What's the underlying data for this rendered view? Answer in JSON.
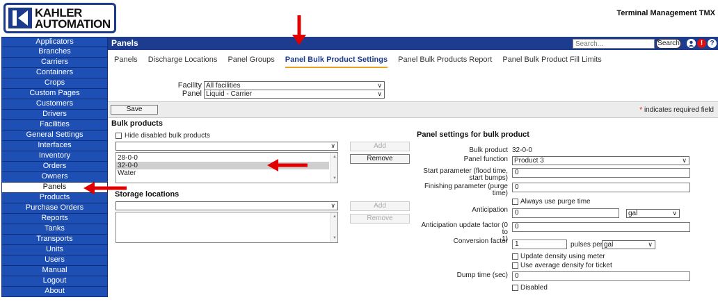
{
  "brand": {
    "logo_line1": "KAHLER",
    "logo_line2": "AUTOMATION",
    "app_title": "Terminal Management TMX"
  },
  "sidebar": {
    "items": [
      {
        "label": "Applicators"
      },
      {
        "label": "Branches"
      },
      {
        "label": "Carriers"
      },
      {
        "label": "Containers"
      },
      {
        "label": "Crops"
      },
      {
        "label": "Custom Pages"
      },
      {
        "label": "Customers"
      },
      {
        "label": "Drivers"
      },
      {
        "label": "Facilities"
      },
      {
        "label": "General Settings"
      },
      {
        "label": "Interfaces"
      },
      {
        "label": "Inventory"
      },
      {
        "label": "Orders"
      },
      {
        "label": "Owners"
      },
      {
        "label": "Panels"
      },
      {
        "label": "Products"
      },
      {
        "label": "Purchase Orders"
      },
      {
        "label": "Reports"
      },
      {
        "label": "Tanks"
      },
      {
        "label": "Transports"
      },
      {
        "label": "Units"
      },
      {
        "label": "Users"
      },
      {
        "label": "Manual"
      },
      {
        "label": "Logout"
      },
      {
        "label": "About"
      }
    ],
    "active_label": "Panels"
  },
  "header": {
    "title": "Panels",
    "search_placeholder": "Search...",
    "search_button": "Search",
    "icons": [
      "user-icon",
      "alert-icon",
      "help-icon"
    ],
    "alert_glyph": "!",
    "help_glyph": "?"
  },
  "tabs": [
    {
      "label": "Panels"
    },
    {
      "label": "Discharge Locations"
    },
    {
      "label": "Panel Groups"
    },
    {
      "label": "Panel Bulk Product Settings"
    },
    {
      "label": "Panel Bulk Products Report"
    },
    {
      "label": "Panel Bulk Product Fill Limits"
    }
  ],
  "active_tab": "Panel Bulk Product Settings",
  "filters": {
    "facility_label": "Facility",
    "facility_value": "All facilities",
    "panel_label": "Panel",
    "panel_value": "Liquid - Carrier"
  },
  "toolbar": {
    "save_label": "Save",
    "required_asterisk": "*",
    "required_note": "indicates required field"
  },
  "bulk_products": {
    "title": "Bulk products",
    "hide_disabled_label": "Hide disabled bulk products",
    "add_label": "Add",
    "remove_label": "Remove",
    "list": [
      "28-0-0",
      "32-0-0",
      "Water"
    ],
    "selected": "32-0-0"
  },
  "storage_locations": {
    "title": "Storage locations",
    "add_label": "Add",
    "remove_label": "Remove"
  },
  "panel_settings": {
    "title": "Panel settings for bulk product",
    "bulk_product_label": "Bulk product",
    "bulk_product_value": "32-0-0",
    "panel_function_label": "Panel function",
    "panel_function_value": "Product 3",
    "start_param_label_1": "Start parameter (flood time,",
    "start_param_label_2": "start bumps)",
    "start_param_value": "0",
    "finishing_param_label_1": "Finishing parameter (purge",
    "finishing_param_label_2": "time)",
    "finishing_param_value": "0",
    "always_purge_label": "Always use purge time",
    "anticipation_label": "Anticipation",
    "anticipation_value": "0",
    "anticipation_unit": "gal",
    "anticipation_factor_label_1": "Anticipation update factor (0 to",
    "anticipation_factor_label_2": "1)",
    "anticipation_factor_value": "0",
    "conversion_label": "Conversion factor",
    "conversion_value": "1",
    "pulses_per_label": "pulses per",
    "pulses_unit": "gal",
    "update_density_label": "Update density using meter",
    "avg_density_label": "Use average density for ticket",
    "dump_time_label": "Dump time (sec)",
    "dump_time_value": "0",
    "disabled_label": "Disabled"
  },
  "colors": {
    "nav_blue": "#1e4fb5",
    "header_blue": "#1e3c8f",
    "tab_underline": "#e8a020",
    "annotation_red": "#e10000"
  }
}
